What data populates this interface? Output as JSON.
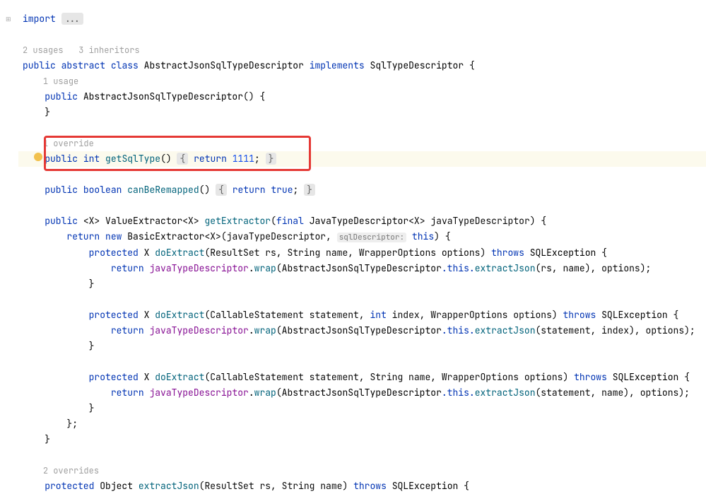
{
  "editor": {
    "import": {
      "keyword": "import",
      "fold": "..."
    },
    "usages1": "2 usages   3 inheritors",
    "classdecl": {
      "kw_public": "public",
      "kw_abstract": "abstract",
      "kw_class": "class",
      "name": "AbstractJsonSqlTypeDescriptor",
      "kw_implements": "implements",
      "iface": "SqlTypeDescriptor",
      "brace": "{"
    },
    "usage_ctor": "1 usage",
    "ctor": {
      "kw": "public",
      "name": "AbstractJsonSqlTypeDescriptor",
      "rest": "() {"
    },
    "ctor_close": "}",
    "override1": "1 override",
    "getSqlType": {
      "kw_public": "public",
      "type": "int",
      "name": "getSqlType",
      "parens": "()",
      "brace_l": "{",
      "kw_return": "return",
      "val": "1111",
      "semi": ";",
      "brace_r": "}"
    },
    "canBeRemapped": {
      "kw_public": "public",
      "type": "boolean",
      "name": "canBeRemapped",
      "parens": "()",
      "brace_l": "{",
      "kw_return": "return",
      "val": "true",
      "semi": ";",
      "brace_r": "}"
    },
    "getExtractor": {
      "kw_public": "public",
      "gen": "<X>",
      "ret": "ValueExtractor",
      "genret": "<X>",
      "name": "getExtractor",
      "args_open": "(",
      "kw_final": "final",
      "argtype": "JavaTypeDescriptor",
      "gen2": "<X>",
      "argname": "javaTypeDescriptor",
      "args_close": ")",
      "brace": "{"
    },
    "return_new": {
      "kw_return": "return",
      "kw_new": "new",
      "cls": "BasicExtractor",
      "gen": "<X>",
      "open": "(",
      "arg1": "javaTypeDescriptor",
      "comma": ",",
      "hint": "sqlDescriptor:",
      "arg2": "this",
      "close": ")",
      "brace": "{"
    },
    "doEx1": {
      "kw_protected": "protected",
      "ret": "X",
      "name": "doExtract",
      "sig": "(ResultSet rs, String name, WrapperOptions options)",
      "kw_throws": "throws",
      "exc": "SQLException",
      "brace": "{"
    },
    "doEx1_body": {
      "kw_return": "return",
      "obj": "javaTypeDescriptor",
      "dot": ".",
      "m1": "wrap",
      "open": "(",
      "cls": "AbstractJsonSqlTypeDescriptor",
      "this": ".this.",
      "m2": "extractJson",
      "args": "(rs, name)",
      "comma": ", ",
      "arg2": "options",
      "close": ");"
    },
    "brace_close1": "}",
    "doEx2": {
      "kw_protected": "protected",
      "ret": "X",
      "name": "doExtract",
      "sig": "(CallableStatement statement, ",
      "kw_int": "int",
      "sig2": " index, WrapperOptions options)",
      "kw_throws": "throws",
      "exc": "SQLException",
      "brace": "{"
    },
    "doEx2_body": {
      "kw_return": "return",
      "obj": "javaTypeDescriptor",
      "dot": ".",
      "m1": "wrap",
      "open": "(",
      "cls": "AbstractJsonSqlTypeDescriptor",
      "this": ".this.",
      "m2": "extractJson",
      "args": "(statement, index)",
      "comma": ", ",
      "arg2": "options",
      "close": ");"
    },
    "brace_close2": "}",
    "doEx3": {
      "kw_protected": "protected",
      "ret": "X",
      "name": "doExtract",
      "sig": "(CallableStatement statement, String name, WrapperOptions options)",
      "kw_throws": "throws",
      "exc": "SQLException",
      "brace": "{"
    },
    "doEx3_body": {
      "kw_return": "return",
      "obj": "javaTypeDescriptor",
      "dot": ".",
      "m1": "wrap",
      "open": "(",
      "cls": "AbstractJsonSqlTypeDescriptor",
      "this": ".this.",
      "m2": "extractJson",
      "args": "(statement, name)",
      "comma": ", ",
      "arg2": "options",
      "close": ");"
    },
    "brace_close3": "}",
    "anon_close": "};",
    "method_close": "}",
    "overrides2": "2 overrides",
    "extractJson": {
      "kw_protected": "protected",
      "ret": "Object",
      "name": "extractJson",
      "sig": "(ResultSet rs, String name)",
      "kw_throws": "throws",
      "exc": "SQLException",
      "brace": "{"
    }
  }
}
